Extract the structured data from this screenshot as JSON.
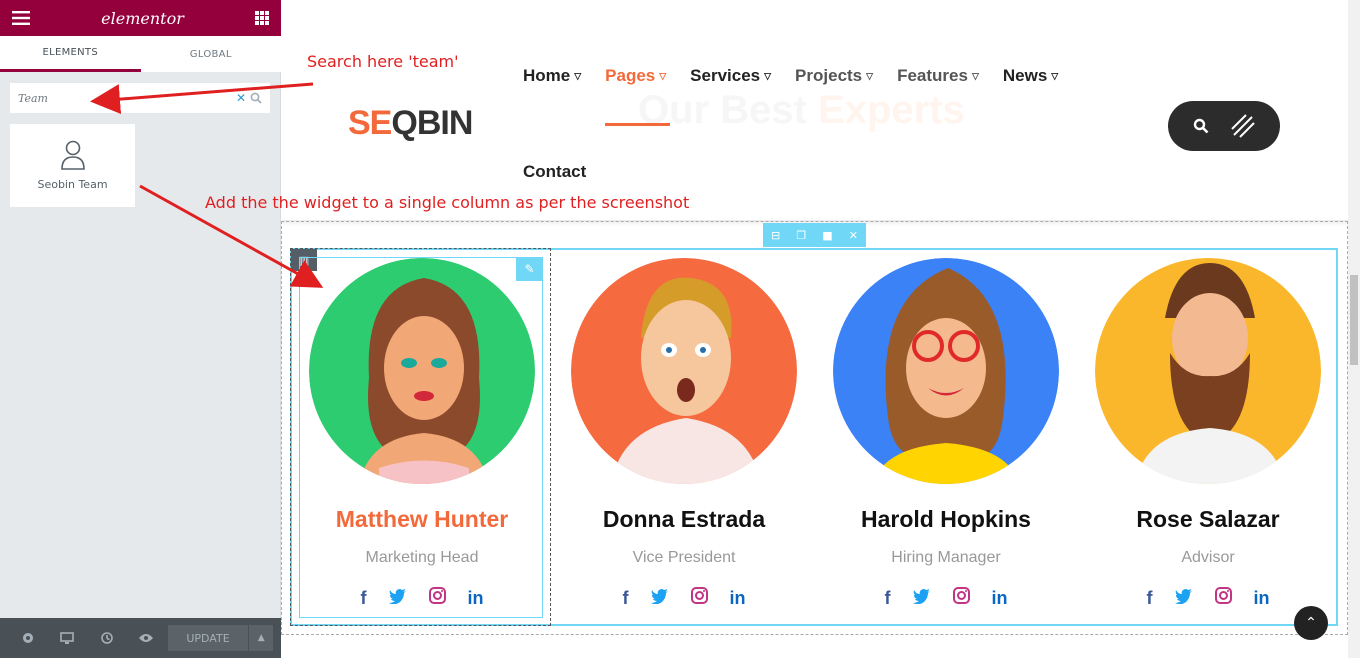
{
  "panel": {
    "logo": "elementor",
    "tabs": [
      "ELEMENTS",
      "GLOBAL"
    ],
    "search_value": "Team",
    "widget_label": "Seobin Team",
    "update_label": "UPDATE"
  },
  "site": {
    "bg_title_a": "Our Best",
    "bg_title_b": "Experts",
    "brand_a": "SE",
    "brand_b": "Q",
    "brand_c": "BIN",
    "nav": [
      "Home",
      "Pages",
      "Services",
      "Projects",
      "Features",
      "News"
    ],
    "contact": "Contact"
  },
  "team": [
    {
      "name": "Matthew Hunter",
      "role": "Marketing Head",
      "color": "#2ecc71"
    },
    {
      "name": "Donna Estrada",
      "role": "Vice President",
      "color": "#f66a3f"
    },
    {
      "name": "Harold Hopkins",
      "role": "Hiring Manager",
      "color": "#3b82f6"
    },
    {
      "name": "Rose Salazar",
      "role": "Advisor",
      "color": "#fbb72c"
    }
  ],
  "social": {
    "fb": "f",
    "tw": "t",
    "ig": "ig",
    "li": "in"
  },
  "annotations": {
    "search_note": "Search here 'team'",
    "add_note": "Add the the widget to a single column as per the screenshot"
  },
  "icons": [
    "hamburger-icon",
    "apps-grid-icon",
    "search-icon",
    "clear-icon",
    "user-icon",
    "settings-icon",
    "desktop-icon",
    "history-icon",
    "eye-icon",
    "chevron-up-icon",
    "search-icon",
    "lines-icon",
    "arrow-up-icon"
  ]
}
